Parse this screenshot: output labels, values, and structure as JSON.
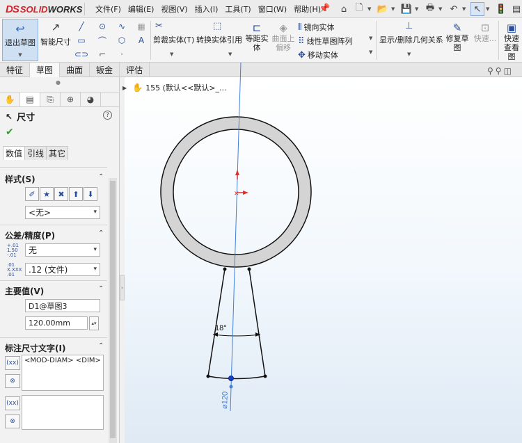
{
  "app": {
    "logo_ds": "DS",
    "logo_name_a": "SOLID",
    "logo_name_b": "WORKS"
  },
  "menu": [
    "文件(F)",
    "编辑(E)",
    "视图(V)",
    "插入(I)",
    "工具(T)",
    "窗口(W)",
    "帮助(H)"
  ],
  "ribbon": {
    "exit_sketch": "退出草图",
    "smart_dimension": "智能尺寸",
    "trim": "剪裁实体(T)",
    "convert": "转换实体引用",
    "offset": "等距实体",
    "surface_offset": "曲面上偏移",
    "mirror": "镜向实体",
    "linear_pattern": "线性草图阵列",
    "move": "移动实体",
    "relations": "显示/删除几何关系",
    "repair": "修复草图",
    "quick_snaps": "快速...",
    "quick_view": "快速查看图"
  },
  "tabs": [
    "特征",
    "草图",
    "曲面",
    "钣金",
    "评估"
  ],
  "active_tab": "草图",
  "property_manager": {
    "title": "尺寸",
    "subtabs": [
      "数值",
      "引线",
      "其它"
    ],
    "style_header": "样式(S)",
    "style_value": "<无>",
    "tolerance_header": "公差/精度(P)",
    "tolerance_value": "无",
    "precision_value": ".12 (文件)",
    "tol_icon_1": "1.50",
    "tol_icon_2": "+.01",
    "tol_icon_3": "-.01",
    "prec_icon_1": ".01",
    "prec_icon_2": "X.XXX",
    "prec_icon_3": ".01",
    "primary_header": "主要值(V)",
    "primary_name": "D1@草图3",
    "primary_value": "120.00mm",
    "dimtext_header": "标注尺寸文字(I)",
    "dimtext_value": "<MOD-DIAM> <DIM>",
    "dimtext_value_2": ""
  },
  "tree": {
    "label": "155  (默认<<默认>_..."
  },
  "sketch": {
    "angle_label": "18°",
    "dim_label": "⌀120"
  },
  "colors": {
    "ring_fill": "#d4d4d4",
    "centerline": "#3f7fd8",
    "origin": "#e03030",
    "point": "#1a3fc4"
  }
}
